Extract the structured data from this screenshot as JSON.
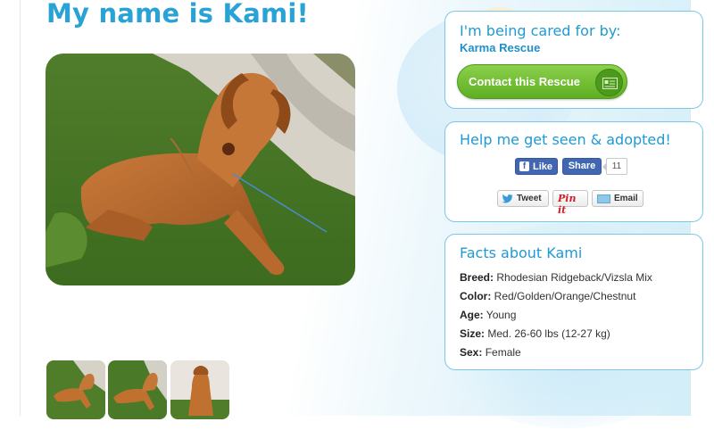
{
  "pet": {
    "title": "My name is Kami!"
  },
  "photos": {
    "main_alt": "Kami",
    "thumbnails": [
      {
        "alt": "Kami photo 1"
      },
      {
        "alt": "Kami photo 2"
      },
      {
        "alt": "Kami photo 3"
      }
    ]
  },
  "care": {
    "heading": "I'm being cared for by:",
    "rescue_name": "Karma Rescue",
    "contact_button": "Contact this Rescue",
    "contact_icon": "card-icon"
  },
  "share": {
    "heading": "Help me get seen & adopted!",
    "fb_like": "Like",
    "fb_share": "Share",
    "fb_count": "11",
    "tweet": "Tweet",
    "pinit": "Pin it",
    "email": "Email"
  },
  "facts": {
    "heading": "Facts about Kami",
    "rows": [
      {
        "key": "Breed:",
        "value": "Rhodesian Ridgeback/Vizsla Mix"
      },
      {
        "key": "Color:",
        "value": "Red/Golden/Orange/Chestnut"
      },
      {
        "key": "Age:",
        "value": "Young"
      },
      {
        "key": "Size:",
        "value": "Med. 26-60 lbs (12-27 kg)"
      },
      {
        "key": "Sex:",
        "value": "Female"
      }
    ]
  },
  "colors": {
    "title_blue": "#29a3d6",
    "card_border": "#7cc7e8",
    "button_green": "#6bbf2e",
    "facebook_blue": "#4267b2"
  }
}
